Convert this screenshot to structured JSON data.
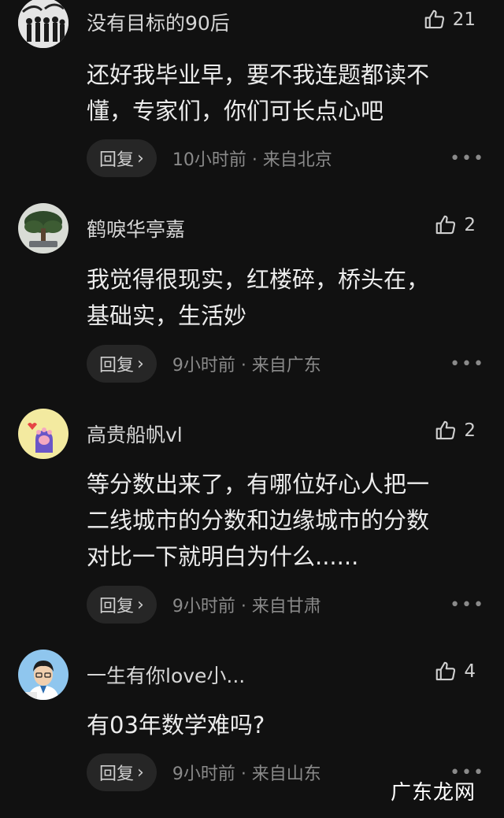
{
  "comments": [
    {
      "username": "没有目标的90后",
      "likes": "21",
      "lines": [
        "还好我毕业早，要不我连题都读不",
        "懂，专家们，你们可长点心吧"
      ],
      "reply_label": "回复",
      "meta": "10小时前 · 来自北京",
      "avatar_icon": "group-silhouette-avatar"
    },
    {
      "username": "鹤唳华亭嘉",
      "likes": "2",
      "lines": [
        "我觉得很现实，红楼碎，桥头在，",
        "基础实，生活妙"
      ],
      "reply_label": "回复",
      "meta": "9小时前 · 来自广东",
      "avatar_icon": "bonsai-tree-avatar"
    },
    {
      "username": "高贵船帆vl",
      "likes": "2",
      "lines": [
        "等分数出来了，有哪位好心人把一",
        "二线城市的分数和边缘城市的分数",
        "对比一下就明白为什么......"
      ],
      "reply_label": "回复",
      "meta": "9小时前 · 来自甘肃",
      "avatar_icon": "cat-paw-avatar"
    },
    {
      "username": "一生有你love小...",
      "likes": "4",
      "lines": [
        "有03年数学难吗?"
      ],
      "reply_label": "回复",
      "meta": "9小时前 · 来自山东",
      "avatar_icon": "cartoon-doctor-avatar"
    }
  ],
  "watermark": "广东龙网",
  "colors": {
    "background": "#111111",
    "reply_bg": "#262626",
    "meta": "#8a8a8a"
  }
}
